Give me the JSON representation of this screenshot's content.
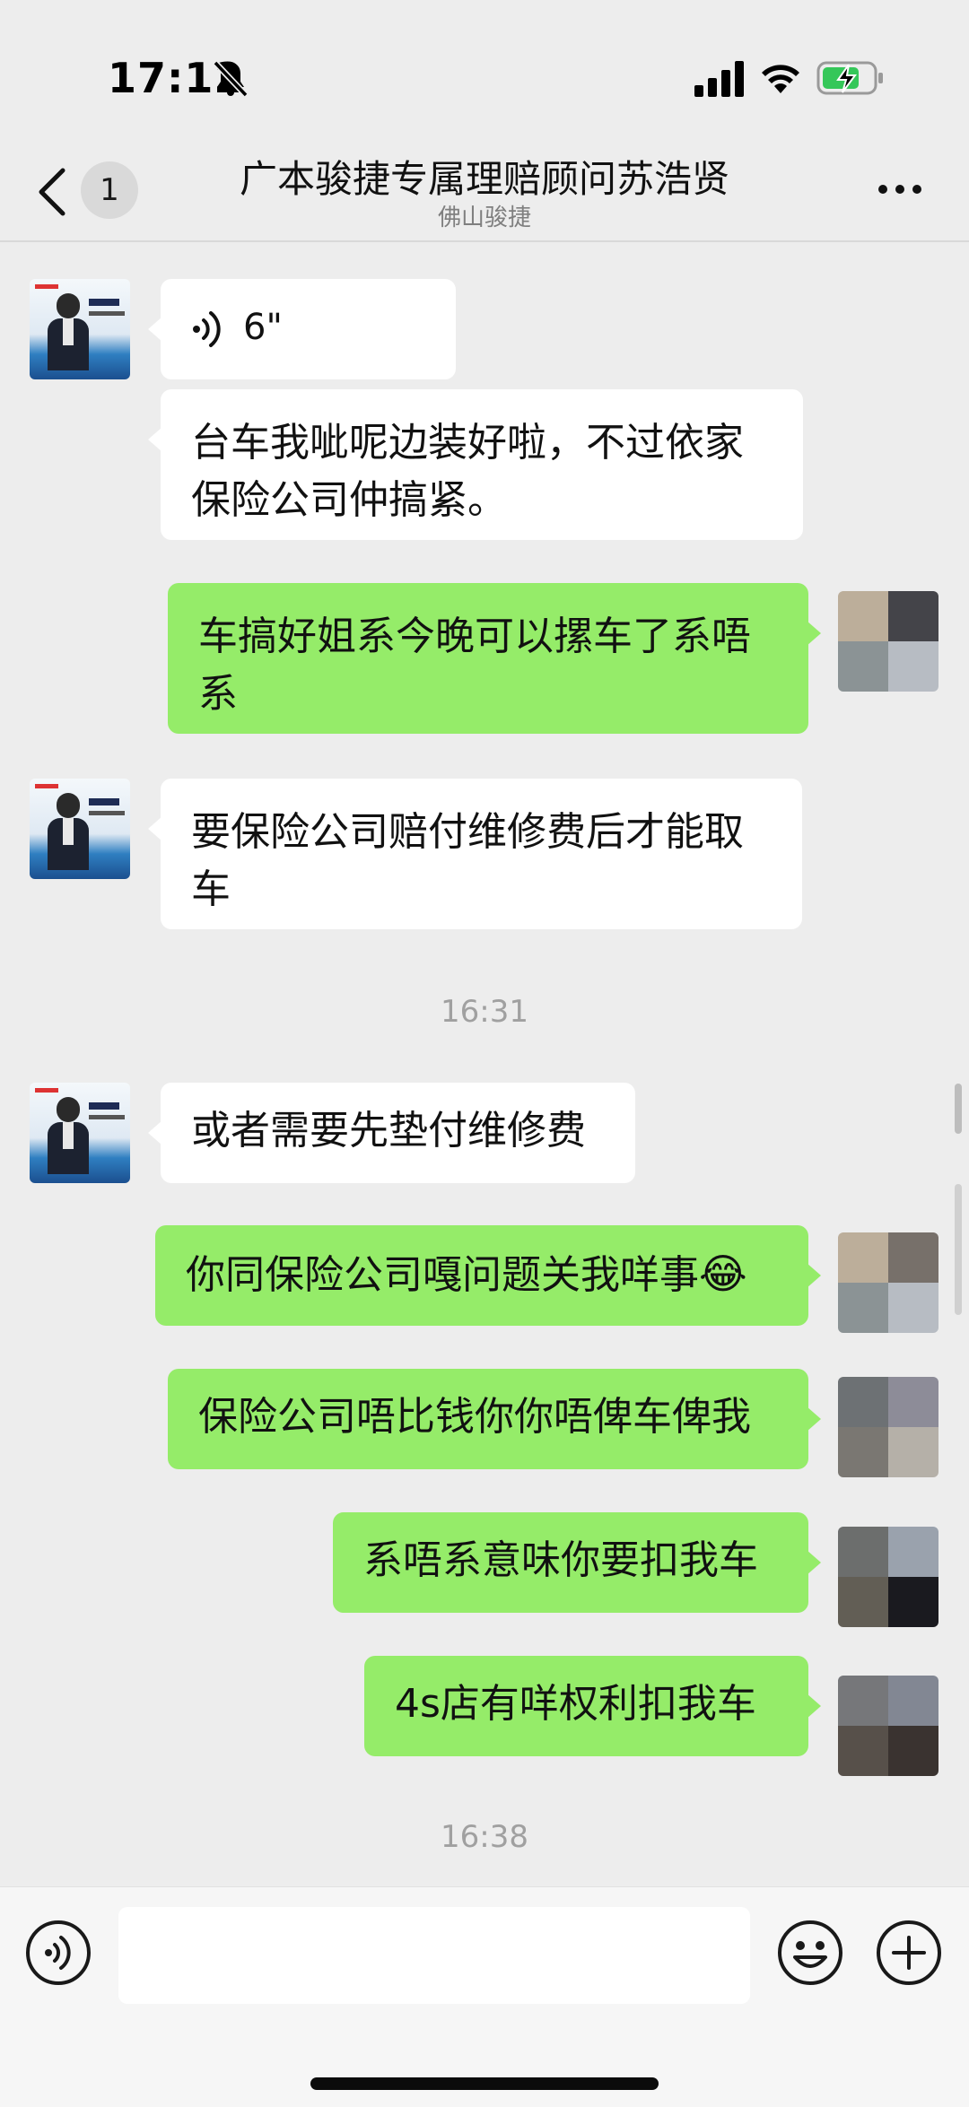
{
  "status_bar": {
    "time": "17:12",
    "icons": [
      "bell-slash-icon",
      "cellular-signal-icon",
      "wifi-icon",
      "battery-charging-icon"
    ]
  },
  "nav": {
    "unread_count": "1",
    "title": "广本骏捷专属理赔顾问苏浩贤",
    "subtitle": "佛山骏捷",
    "icons": [
      "chevron-left-icon",
      "more-icon"
    ]
  },
  "messages": [
    {
      "side": "left",
      "type": "voice",
      "duration": "6\""
    },
    {
      "side": "left",
      "type": "text",
      "lines": [
        "台车我呲呢边装好啦，不过依家",
        "保险公司仲搞紧。"
      ]
    },
    {
      "side": "right",
      "type": "text",
      "lines": [
        "车搞好姐系今晚可以摞车了系唔",
        "系"
      ]
    },
    {
      "side": "left",
      "type": "text",
      "lines": [
        "要保险公司赔付维修费后才能取",
        "车"
      ]
    },
    {
      "type": "timestamp",
      "text": "16:31"
    },
    {
      "side": "left",
      "type": "text",
      "lines": [
        "或者需要先垫付维修费"
      ]
    },
    {
      "side": "right",
      "type": "text",
      "lines": [
        "你同保险公司嘎问题关我咩事"
      ],
      "emoji": "😂"
    },
    {
      "side": "right",
      "type": "text",
      "lines": [
        "保险公司唔比钱你你唔俾车俾我"
      ]
    },
    {
      "side": "right",
      "type": "text",
      "lines": [
        "系唔系意味你要扣我车"
      ]
    },
    {
      "side": "right",
      "type": "text",
      "lines": [
        "4s店有咩权利扣我车"
      ]
    },
    {
      "type": "timestamp",
      "text": "16:38"
    }
  ],
  "input_bar": {
    "placeholder": "",
    "icons": [
      "voice-input-icon",
      "emoji-icon",
      "plus-icon"
    ]
  },
  "colors": {
    "background": "#ededed",
    "bubble_self": "#95ec69",
    "bubble_other": "#ffffff",
    "timestamp": "#a0a0a0"
  }
}
